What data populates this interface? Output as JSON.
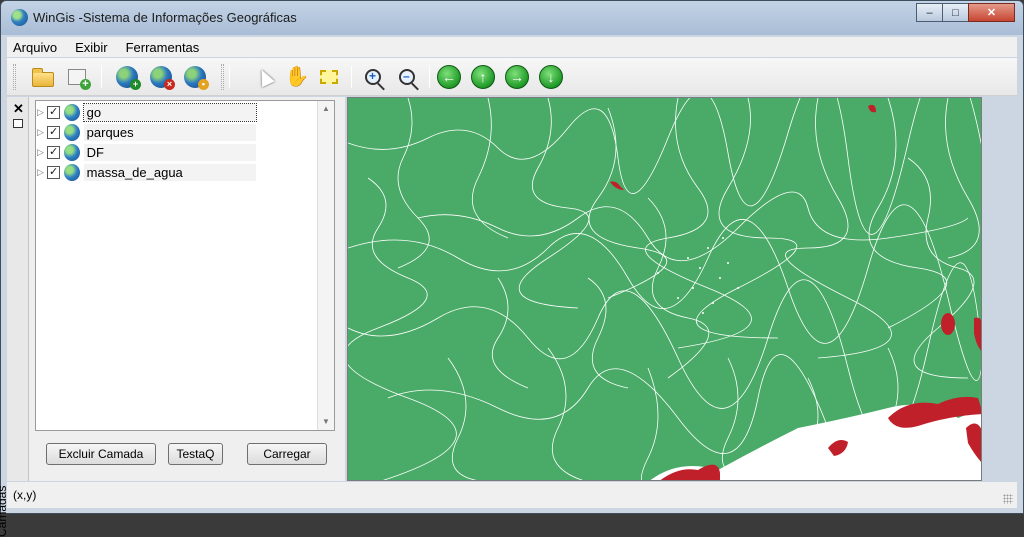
{
  "window": {
    "title": "WinGis -Sistema de Informações Geográficas",
    "controls": [
      "minimize",
      "maximize",
      "close"
    ]
  },
  "menu": [
    "Arquivo",
    "Exibir",
    "Ferramentas"
  ],
  "toolbar": {
    "buttons": [
      {
        "name": "open-icon"
      },
      {
        "name": "new-layer-icon"
      },
      {
        "name": "add-layer-globe-icon"
      },
      {
        "name": "remove-layer-globe-icon"
      },
      {
        "name": "layer-properties-globe-icon"
      },
      {
        "name": "select-arrow-icon"
      },
      {
        "name": "pan-hand-icon"
      },
      {
        "name": "select-rectangle-icon"
      },
      {
        "name": "zoom-in-icon"
      },
      {
        "name": "zoom-out-icon"
      },
      {
        "name": "pan-left-icon"
      },
      {
        "name": "pan-up-icon"
      },
      {
        "name": "pan-right-icon"
      },
      {
        "name": "pan-down-icon"
      }
    ]
  },
  "side_panel": {
    "tab_label": "Camadas"
  },
  "layers": [
    {
      "name": "go",
      "checked": true,
      "selected": true
    },
    {
      "name": "parques",
      "checked": true,
      "selected": false
    },
    {
      "name": "DF",
      "checked": true,
      "selected": false
    },
    {
      "name": "massa_de_agua",
      "checked": true,
      "selected": false
    }
  ],
  "buttons": {
    "delete_layer": "Excluir Camada",
    "test": "TestaQ",
    "load": "Carregar"
  },
  "status": {
    "coordinates": "(x,y)"
  },
  "colors": {
    "map_land": "#4aab68",
    "map_borders": "#ffffff",
    "map_water": "#c0202a",
    "map_outside": "#ffffff"
  }
}
